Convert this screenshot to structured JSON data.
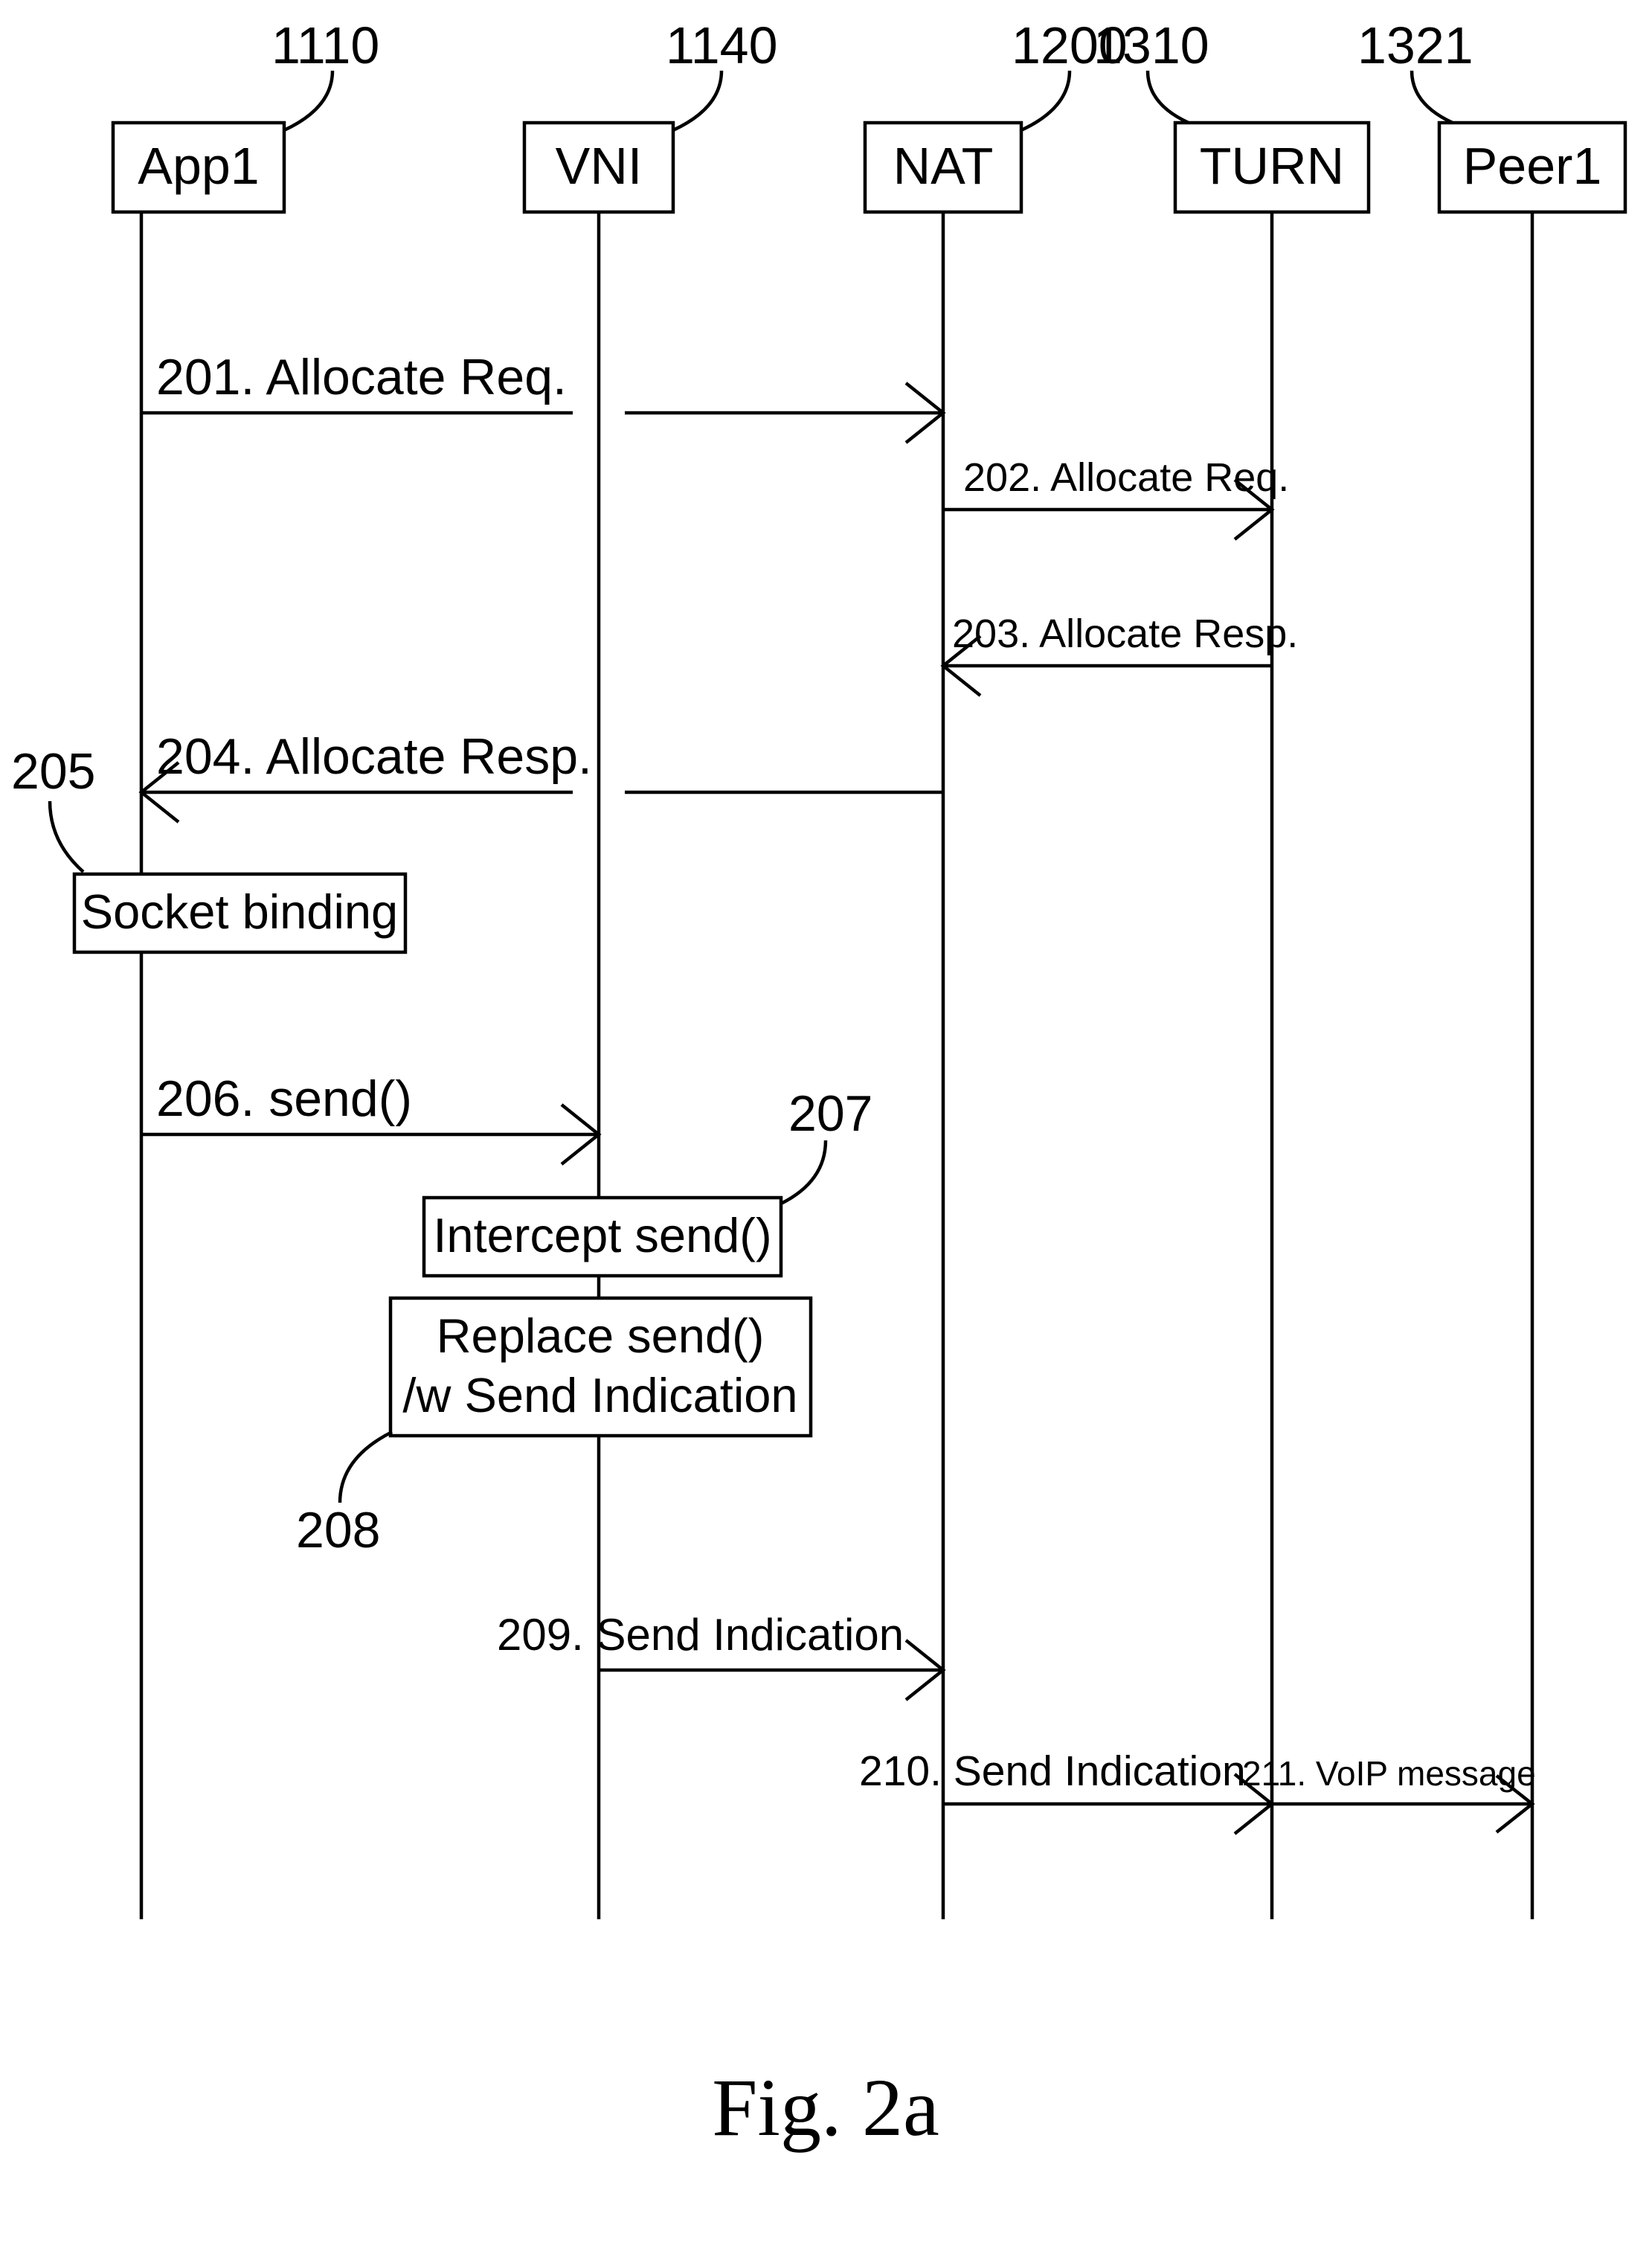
{
  "chart_data": {
    "type": "sequence-diagram",
    "participants": [
      {
        "id": "app1",
        "label": "App1",
        "ref": "1110"
      },
      {
        "id": "vni",
        "label": "VNI",
        "ref": "1140"
      },
      {
        "id": "nat",
        "label": "NAT",
        "ref": "1200"
      },
      {
        "id": "turn",
        "label": "TURN",
        "ref": "1310"
      },
      {
        "id": "peer1",
        "label": "Peer1",
        "ref": "1321"
      }
    ],
    "messages": [
      {
        "num": "201",
        "text": "201. Allocate Req.",
        "from": "app1",
        "to": "vni",
        "pass_through": true
      },
      {
        "num": "202",
        "text": "202. Allocate Req.",
        "from": "nat",
        "to": "turn"
      },
      {
        "num": "203",
        "text": "203. Allocate Resp.",
        "from": "turn",
        "to": "nat"
      },
      {
        "num": "204",
        "text": "204. Allocate Resp.",
        "from": "vni",
        "to": "app1",
        "pass_through": true
      },
      {
        "num": "206",
        "text": "206. send()",
        "from": "app1",
        "to": "vni"
      },
      {
        "num": "209",
        "text": "209. Send Indication",
        "from": "vni",
        "to": "nat"
      },
      {
        "num": "210",
        "text": "210. Send Indication",
        "from": "nat",
        "to": "turn"
      },
      {
        "num": "211",
        "text": "211. VoIP message",
        "from": "turn",
        "to": "peer1"
      }
    ],
    "self_actions": [
      {
        "num": "205",
        "text": "Socket binding",
        "on": "app1"
      },
      {
        "num": "207",
        "text": "Intercept send()",
        "on": "vni"
      },
      {
        "num": "208",
        "text_line1": "Replace send()",
        "text_line2": "/w Send Indication",
        "on": "vni"
      }
    ],
    "caption": "Fig. 2a"
  }
}
